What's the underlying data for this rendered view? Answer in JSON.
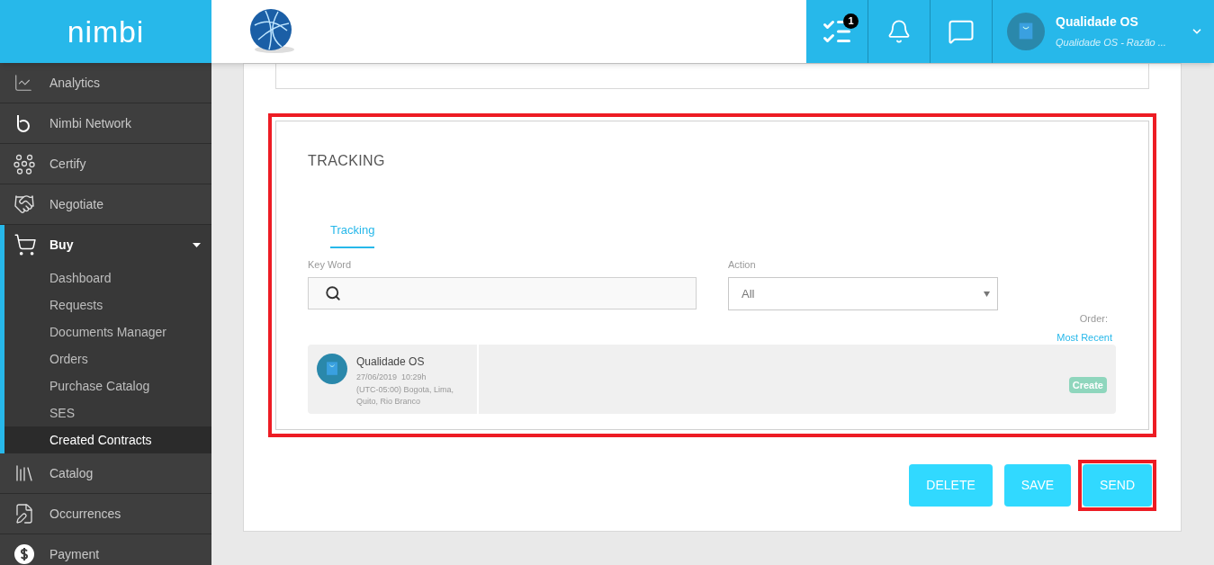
{
  "header": {
    "logo": "nimbi",
    "notifications_badge": "1",
    "user": {
      "name": "Qualidade OS",
      "company": "Qualidade OS - Razão ..."
    }
  },
  "sidebar": {
    "items": [
      {
        "label": "Analytics",
        "selected": false
      },
      {
        "label": "Nimbi Network",
        "selected": false
      },
      {
        "label": "Certify",
        "selected": false
      },
      {
        "label": "Negotiate",
        "selected": false
      },
      {
        "label": "Buy",
        "selected": true,
        "expanded": true,
        "children": [
          {
            "label": "Dashboard",
            "selected": false
          },
          {
            "label": "Requests",
            "selected": false
          },
          {
            "label": "Documents Manager",
            "selected": false
          },
          {
            "label": "Orders",
            "selected": false
          },
          {
            "label": "Purchase Catalog",
            "selected": false
          },
          {
            "label": "SES",
            "selected": false
          },
          {
            "label": "Created Contracts",
            "selected": true
          }
        ]
      },
      {
        "label": "Catalog",
        "selected": false
      },
      {
        "label": "Occurrences",
        "selected": false
      },
      {
        "label": "Payment",
        "selected": false
      }
    ]
  },
  "tracking": {
    "title": "TRACKING",
    "highlighted": true,
    "tabs": [
      {
        "label": "Tracking",
        "selected": true
      }
    ],
    "keyword": {
      "label": "Key Word"
    },
    "action": {
      "label": "Action",
      "value": "All"
    },
    "order": {
      "label": "Order:",
      "value": "Most Recent"
    },
    "entries": [
      {
        "user": "Qualidade OS",
        "date": "27/06/2019  10:29h",
        "timezone": "(UTC-05:00) Bogota, Lima, Quito, Rio Branco",
        "action": "Create"
      }
    ]
  },
  "buttons": [
    {
      "label": "DELETE",
      "highlighted": false
    },
    {
      "label": "SAVE",
      "highlighted": false
    },
    {
      "label": "SEND",
      "highlighted": true
    }
  ]
}
